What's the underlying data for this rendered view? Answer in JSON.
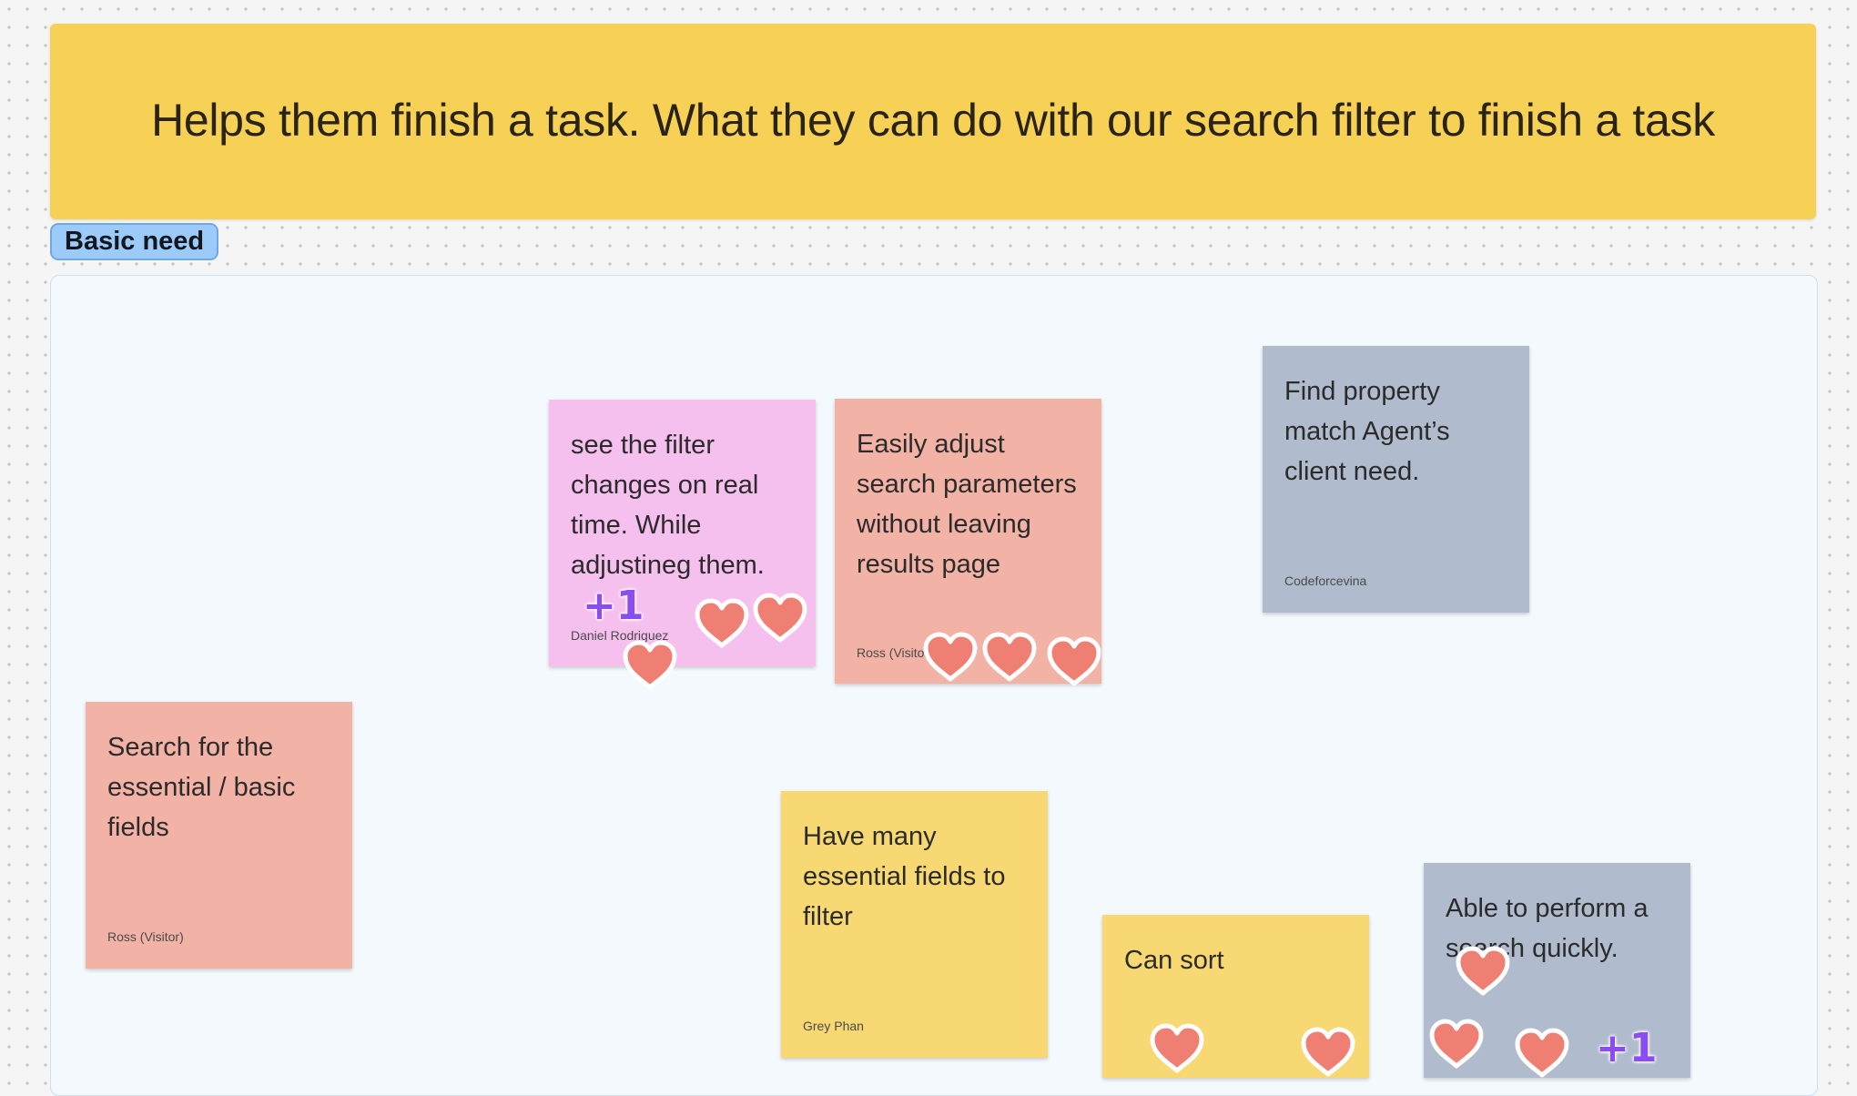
{
  "board": {
    "banner_text": "Helps them finish a task. What they can do with our search filter to finish a task",
    "section_label": "Basic need"
  },
  "stickies": [
    {
      "text": "see the filter changes on real time. While adjustineg them.",
      "author": "Daniel Rodriguez",
      "color": "#f5c0ee"
    },
    {
      "text": "Easily adjust search parameters without leaving results page",
      "author": "Ross (Visitor)",
      "color": "#f2b2a6"
    },
    {
      "text": "Find property match Agent’s client need.",
      "author": "Codeforcevina",
      "color": "#b0bccd"
    },
    {
      "text": "Search for the essential / basic fields",
      "author": "Ross (Visitor)",
      "color": "#f2b2a6"
    },
    {
      "text": "Have many essential fields to filter",
      "author": "Grey Phan",
      "color": "#f7d872"
    },
    {
      "text": "Can sort",
      "author": "",
      "color": "#f7d872"
    },
    {
      "text": "Able to perform a search quickly.",
      "author": "",
      "color": "#b0bccd"
    }
  ],
  "stamps": {
    "heart": "heart-stamp-icon",
    "plus_one_label": "+1",
    "heart_color": "#ee7f72",
    "plus_one_color": "#8a4ef0"
  }
}
